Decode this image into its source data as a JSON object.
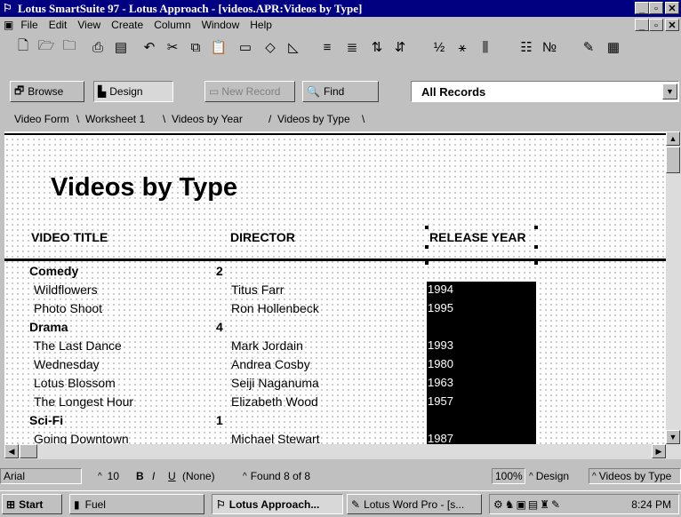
{
  "window": {
    "title": "Lotus SmartSuite 97   -  Lotus Approach - [videos.APR:Videos by Type]"
  },
  "menu": [
    "File",
    "Edit",
    "View",
    "Create",
    "Column",
    "Window",
    "Help"
  ],
  "actions": {
    "browse": "Browse",
    "design": "Design",
    "new_record": "New Record",
    "find": "Find",
    "records_filter": "All Records"
  },
  "tabs": [
    "Video Form",
    "Worksheet 1",
    "Videos by Year",
    "Videos by Type"
  ],
  "report": {
    "title": "Videos by Type",
    "columns": [
      "VIDEO TITLE",
      "DIRECTOR",
      "RELEASE YEAR"
    ],
    "groups": [
      {
        "name": "Comedy",
        "count": "2",
        "rows": [
          {
            "title": "Wildflowers",
            "director": "Titus Farr",
            "year": "1994"
          },
          {
            "title": "Photo Shoot",
            "director": "Ron Hollenbeck",
            "year": "1995"
          }
        ]
      },
      {
        "name": "Drama",
        "count": "4",
        "rows": [
          {
            "title": "The Last Dance",
            "director": "Mark Jordain",
            "year": "1993"
          },
          {
            "title": "Wednesday",
            "director": "Andrea Cosby",
            "year": "1980"
          },
          {
            "title": "Lotus Blossom",
            "director": "Seiji Naganuma",
            "year": "1963"
          },
          {
            "title": "The Longest Hour",
            "director": "Elizabeth Wood",
            "year": "1957"
          }
        ]
      },
      {
        "name": "Sci-Fi",
        "count": "1",
        "rows": [
          {
            "title": "Going Downtown",
            "director": "Michael Stewart",
            "year": "1987"
          }
        ]
      }
    ]
  },
  "status": {
    "font": "Arial",
    "size": "10",
    "bold": "B",
    "italic": "I",
    "underline": "U",
    "style": "(None)",
    "found": "Found 8 of 8",
    "zoom": "100%",
    "mode": "Design",
    "view": "Videos by Type"
  },
  "taskbar": {
    "start": "Start",
    "tasks": [
      "Fuel",
      "Lotus Approach...",
      "Lotus Word Pro - [s..."
    ],
    "clock": "8:24 PM"
  }
}
